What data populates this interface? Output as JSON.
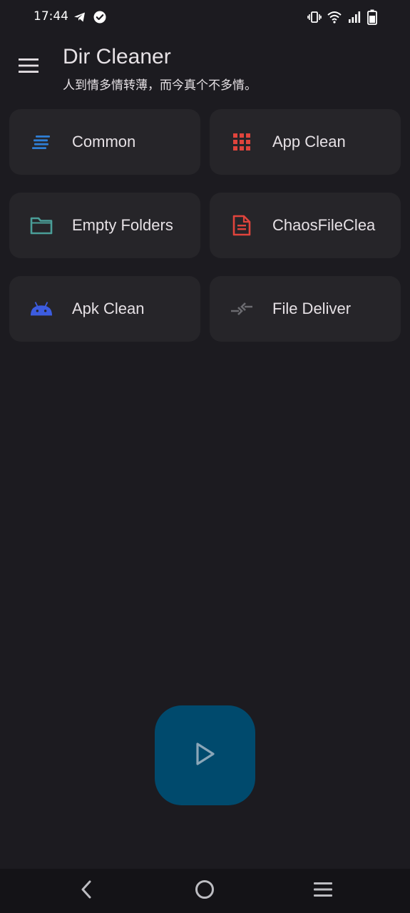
{
  "status_bar": {
    "time": "17:44",
    "left_icons": [
      "telegram-icon",
      "check-circle-icon"
    ],
    "right_icons": [
      "vibrate-icon",
      "wifi-icon",
      "signal-icon",
      "battery-icon"
    ]
  },
  "app_bar": {
    "title": "Dir Cleaner",
    "subtitle": "人到情多情转薄，而今真个不多情。"
  },
  "cards": [
    {
      "label": "Common",
      "icon": "list-lines-icon",
      "color": "#2f7fd6"
    },
    {
      "label": "App Clean",
      "icon": "grid-apps-icon",
      "color": "#e0443c"
    },
    {
      "label": "Empty Folders",
      "icon": "folder-icon",
      "color": "#4a9e98"
    },
    {
      "label": "ChaosFileClea",
      "icon": "document-icon",
      "color": "#e0443c"
    },
    {
      "label": "Apk Clean",
      "icon": "android-icon",
      "color": "#3c5ce0"
    },
    {
      "label": "File Deliver",
      "icon": "compare-arrows-icon",
      "color": "#6b6b70"
    }
  ],
  "fab": {
    "icon": "play-icon"
  },
  "nav_bar": {
    "buttons": [
      "back-icon",
      "home-icon",
      "recents-icon"
    ]
  },
  "colors": {
    "background": "#1c1b20",
    "card": "#262529",
    "fab": "#004a6d",
    "nav": "#141317"
  }
}
